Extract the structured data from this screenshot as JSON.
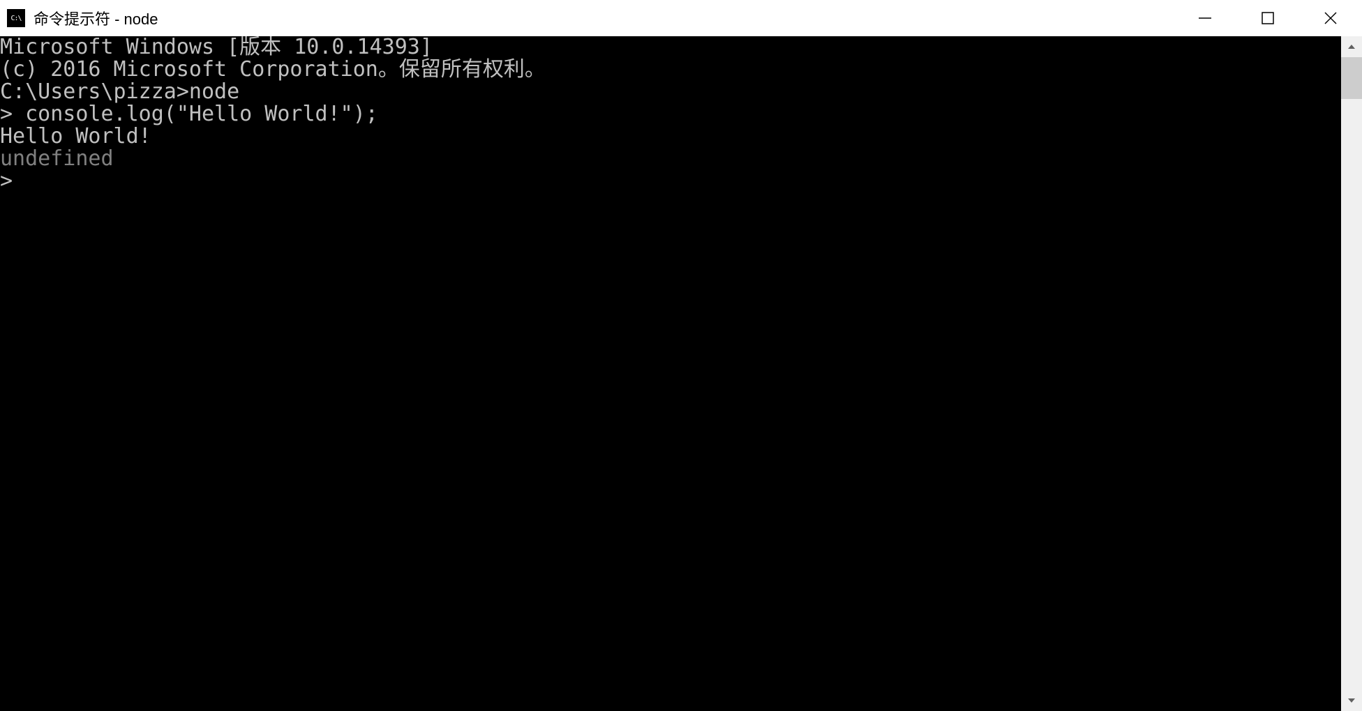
{
  "titlebar": {
    "title": "命令提示符 - node",
    "icon_text": "C:\\"
  },
  "terminal": {
    "line1": "Microsoft Windows [版本 10.0.14393]",
    "line2": "(c) 2016 Microsoft Corporation。保留所有权利。",
    "line3": "",
    "line4": "C:\\Users\\pizza>node",
    "line5_prefix": "> ",
    "line5_cmd": "console.log(\"Hello World!\");",
    "line6": "Hello World!",
    "line7": "undefined",
    "line8": ">"
  }
}
